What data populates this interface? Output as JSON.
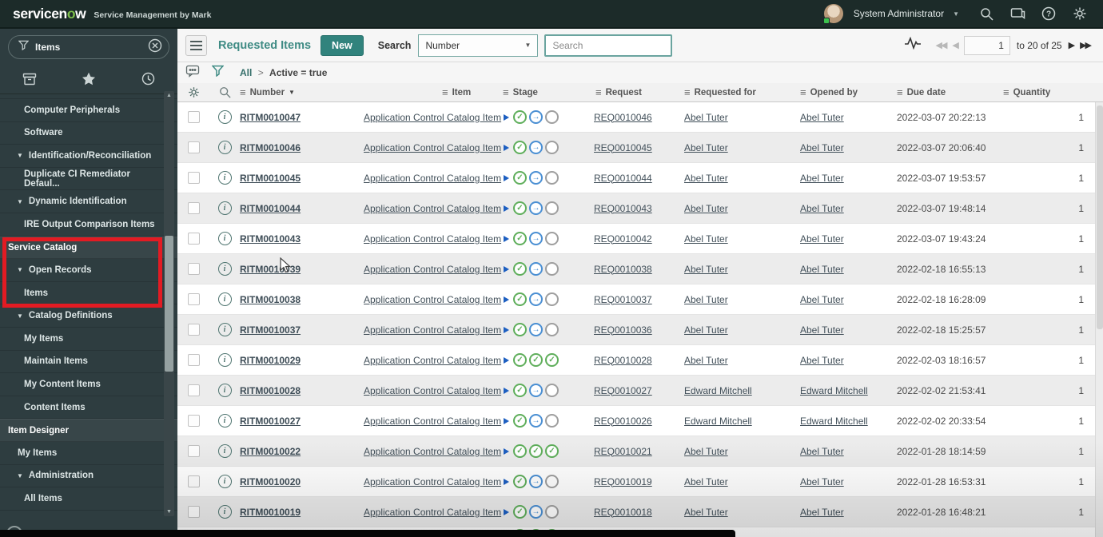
{
  "topbar": {
    "brand": "servicenow",
    "product": "Service Management by Mark",
    "user_menu": "System Administrator",
    "icons": [
      "search-icon",
      "connect-chat-icon",
      "help-icon",
      "settings-gear-icon"
    ]
  },
  "sidebar": {
    "filter_value": "Items",
    "tabs": [
      "all-applications",
      "favorites",
      "history"
    ],
    "annotation_color": "#e31b23",
    "nav": [
      {
        "label": "",
        "type": "clipped"
      },
      {
        "label": "Computer Peripherals",
        "type": "item"
      },
      {
        "label": "Software",
        "type": "item"
      },
      {
        "label": "Identification/Reconciliation",
        "type": "group"
      },
      {
        "label": "Duplicate CI Remediator Defaul...",
        "type": "item"
      },
      {
        "label": "Dynamic Identification",
        "type": "group"
      },
      {
        "label": "IRE Output Comparison Items",
        "type": "item"
      },
      {
        "label": "Service Catalog",
        "type": "section"
      },
      {
        "label": "Open Records",
        "type": "group"
      },
      {
        "label": "Items",
        "type": "item"
      },
      {
        "label": "Catalog Definitions",
        "type": "group"
      },
      {
        "label": "My Items",
        "type": "item"
      },
      {
        "label": "Maintain Items",
        "type": "item"
      },
      {
        "label": "My Content Items",
        "type": "item"
      },
      {
        "label": "Content Items",
        "type": "item"
      },
      {
        "label": "Item Designer",
        "type": "section"
      },
      {
        "label": "My Items",
        "type": "item-lg"
      },
      {
        "label": "Administration",
        "type": "group"
      },
      {
        "label": "All Items",
        "type": "item"
      }
    ]
  },
  "toolbar": {
    "menu_title": "Requested Items",
    "new_button": "New",
    "search_label": "Search",
    "search_field_selected": "Number",
    "search_placeholder": "Search",
    "pagination": {
      "current_page": "1",
      "range_text": "to 20 of 25"
    }
  },
  "filter_bar": {
    "breadcrumb_root": "All",
    "breadcrumb_separator": ">",
    "breadcrumb_condition": "Active = true"
  },
  "table": {
    "columns": [
      "Number",
      "Item",
      "Stage",
      "Request",
      "Requested for",
      "Opened by",
      "Due date",
      "Quantity"
    ],
    "sorted_column": "Number",
    "sort_direction": "desc",
    "stage_legend": {
      "check": "completed",
      "arrow": "in-progress",
      "open": "pending"
    },
    "rows": [
      {
        "number": "RITM0010047",
        "item": "Application Control Catalog Item",
        "stage": [
          "check",
          "arrow",
          "open"
        ],
        "request": "REQ0010046",
        "requested_for": "Abel Tuter",
        "opened_by": "Abel Tuter",
        "due_date": "2022-03-07 20:22:13",
        "quantity": "1"
      },
      {
        "number": "RITM0010046",
        "item": "Application Control Catalog Item",
        "stage": [
          "check",
          "arrow",
          "open"
        ],
        "request": "REQ0010045",
        "requested_for": "Abel Tuter",
        "opened_by": "Abel Tuter",
        "due_date": "2022-03-07 20:06:40",
        "quantity": "1"
      },
      {
        "number": "RITM0010045",
        "item": "Application Control Catalog Item",
        "stage": [
          "check",
          "arrow",
          "open"
        ],
        "request": "REQ0010044",
        "requested_for": "Abel Tuter",
        "opened_by": "Abel Tuter",
        "due_date": "2022-03-07 19:53:57",
        "quantity": "1"
      },
      {
        "number": "RITM0010044",
        "item": "Application Control Catalog Item",
        "stage": [
          "check",
          "arrow",
          "open"
        ],
        "request": "REQ0010043",
        "requested_for": "Abel Tuter",
        "opened_by": "Abel Tuter",
        "due_date": "2022-03-07 19:48:14",
        "quantity": "1"
      },
      {
        "number": "RITM0010043",
        "item": "Application Control Catalog Item",
        "stage": [
          "check",
          "arrow",
          "open"
        ],
        "request": "REQ0010042",
        "requested_for": "Abel Tuter",
        "opened_by": "Abel Tuter",
        "due_date": "2022-03-07 19:43:24",
        "quantity": "1"
      },
      {
        "number": "RITM0010039",
        "item": "Application Control Catalog Item",
        "stage": [
          "check",
          "arrow",
          "open"
        ],
        "request": "REQ0010038",
        "requested_for": "Abel Tuter",
        "opened_by": "Abel Tuter",
        "due_date": "2022-02-18 16:55:13",
        "quantity": "1"
      },
      {
        "number": "RITM0010038",
        "item": "Application Control Catalog Item",
        "stage": [
          "check",
          "arrow",
          "open"
        ],
        "request": "REQ0010037",
        "requested_for": "Abel Tuter",
        "opened_by": "Abel Tuter",
        "due_date": "2022-02-18 16:28:09",
        "quantity": "1"
      },
      {
        "number": "RITM0010037",
        "item": "Application Control Catalog Item",
        "stage": [
          "check",
          "arrow",
          "open"
        ],
        "request": "REQ0010036",
        "requested_for": "Abel Tuter",
        "opened_by": "Abel Tuter",
        "due_date": "2022-02-18 15:25:57",
        "quantity": "1"
      },
      {
        "number": "RITM0010029",
        "item": "Application Control Catalog Item",
        "stage": [
          "check",
          "check",
          "check"
        ],
        "request": "REQ0010028",
        "requested_for": "Abel Tuter",
        "opened_by": "Abel Tuter",
        "due_date": "2022-02-03 18:16:57",
        "quantity": "1"
      },
      {
        "number": "RITM0010028",
        "item": "Application Control Catalog Item",
        "stage": [
          "check",
          "arrow",
          "open"
        ],
        "request": "REQ0010027",
        "requested_for": "Edward Mitchell",
        "opened_by": "Edward Mitchell",
        "due_date": "2022-02-02 21:53:41",
        "quantity": "1"
      },
      {
        "number": "RITM0010027",
        "item": "Application Control Catalog Item",
        "stage": [
          "check",
          "arrow",
          "open"
        ],
        "request": "REQ0010026",
        "requested_for": "Edward Mitchell",
        "opened_by": "Edward Mitchell",
        "due_date": "2022-02-02 20:33:54",
        "quantity": "1"
      },
      {
        "number": "RITM0010022",
        "item": "Application Control Catalog Item",
        "stage": [
          "check",
          "check",
          "check"
        ],
        "request": "REQ0010021",
        "requested_for": "Abel Tuter",
        "opened_by": "Abel Tuter",
        "due_date": "2022-01-28 18:14:59",
        "quantity": "1"
      },
      {
        "number": "RITM0010020",
        "item": "Application Control Catalog Item",
        "stage": [
          "check",
          "arrow",
          "open"
        ],
        "request": "REQ0010019",
        "requested_for": "Abel Tuter",
        "opened_by": "Abel Tuter",
        "due_date": "2022-01-28 16:53:31",
        "quantity": "1"
      },
      {
        "number": "RITM0010019",
        "item": "Application Control Catalog Item",
        "stage": [
          "check",
          "arrow",
          "open"
        ],
        "request": "REQ0010018",
        "requested_for": "Abel Tuter",
        "opened_by": "Abel Tuter",
        "due_date": "2022-01-28 16:48:21",
        "quantity": "1"
      }
    ],
    "partial_row_stage": [
      "check",
      "check",
      "check"
    ]
  }
}
